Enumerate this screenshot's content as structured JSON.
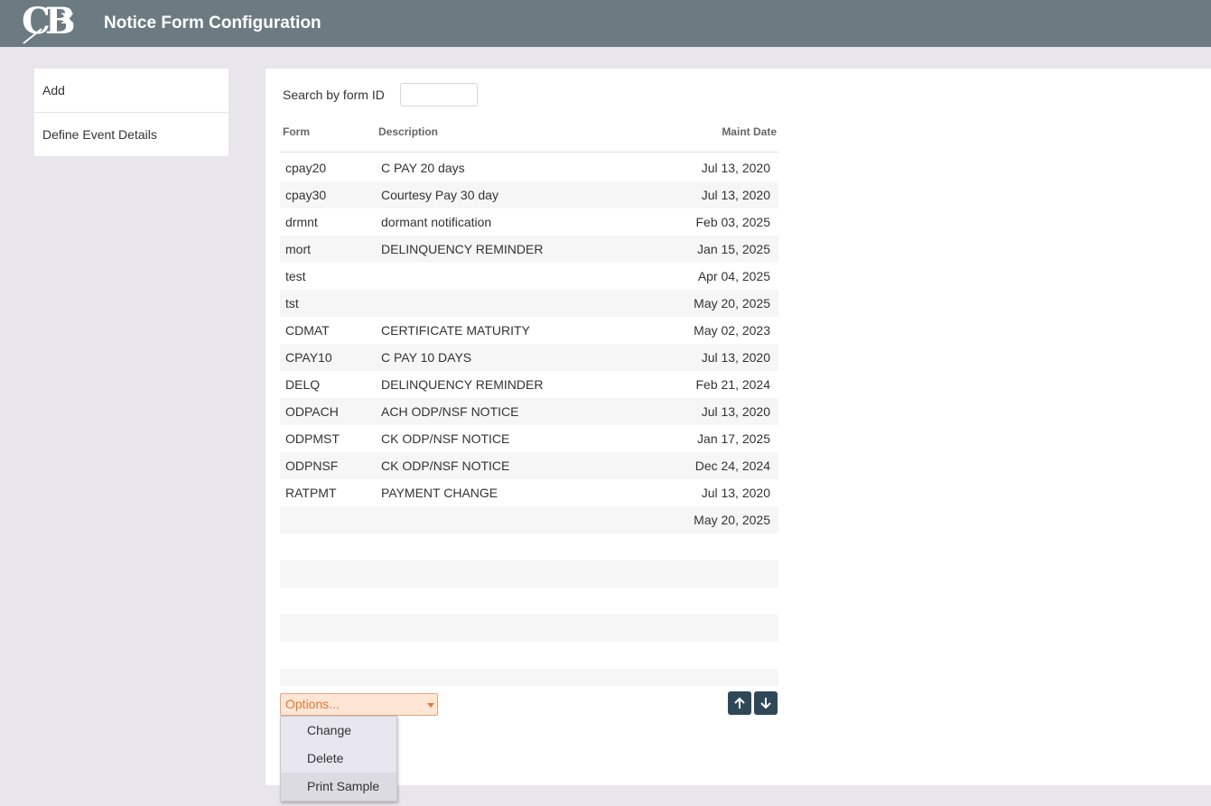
{
  "app": {
    "title": "Notice Form Configuration",
    "logo_text": "CB",
    "logo_mark": "x"
  },
  "sidebar": {
    "items": [
      {
        "label": "Add"
      },
      {
        "label": "Define Event Details"
      }
    ]
  },
  "search": {
    "label": "Search by form ID",
    "value": ""
  },
  "table": {
    "headers": {
      "form": "Form",
      "description": "Description",
      "maint_date": "Maint Date"
    },
    "rows": [
      {
        "form": "cpay20",
        "description": "C PAY 20 days",
        "date": "Jul 13, 2020"
      },
      {
        "form": "cpay30",
        "description": "Courtesy Pay 30 day",
        "date": "Jul 13, 2020"
      },
      {
        "form": "drmnt",
        "description": "dormant notification",
        "date": "Feb 03, 2025"
      },
      {
        "form": "mort",
        "description": "DELINQUENCY REMINDER",
        "date": "Jan 15, 2025"
      },
      {
        "form": "test",
        "description": "",
        "date": "Apr 04, 2025"
      },
      {
        "form": "tst",
        "description": "",
        "date": "May 20, 2025"
      },
      {
        "form": "CDMAT",
        "description": "CERTIFICATE MATURITY",
        "date": "May 02, 2023"
      },
      {
        "form": "CPAY10",
        "description": "C PAY 10 DAYS",
        "date": "Jul 13, 2020"
      },
      {
        "form": "DELQ",
        "description": "DELINQUENCY REMINDER",
        "date": "Feb 21, 2024"
      },
      {
        "form": "ODPACH",
        "description": "ACH ODP/NSF NOTICE",
        "date": "Jul 13, 2020"
      },
      {
        "form": "ODPMST",
        "description": "CK ODP/NSF NOTICE",
        "date": "Jan 17, 2025"
      },
      {
        "form": "ODPNSF",
        "description": "CK ODP/NSF NOTICE",
        "date": "Dec 24, 2024"
      },
      {
        "form": "RATPMT",
        "description": "PAYMENT CHANGE",
        "date": "Jul 13, 2020"
      },
      {
        "form": "",
        "description": "",
        "date": "May 20, 2025"
      }
    ]
  },
  "options": {
    "placeholder": "Options...",
    "menu": [
      {
        "label": "Change"
      },
      {
        "label": "Delete"
      },
      {
        "label": "Print Sample"
      }
    ]
  },
  "icons": {
    "move_up": "arrow-up-icon",
    "move_down": "arrow-down-icon"
  },
  "colors": {
    "header_bar": "#6c7b82",
    "page_bg": "#e8e6ec",
    "options_bg": "#fde6d6",
    "options_text": "#e07a33",
    "arrow_button": "#2f4858"
  }
}
